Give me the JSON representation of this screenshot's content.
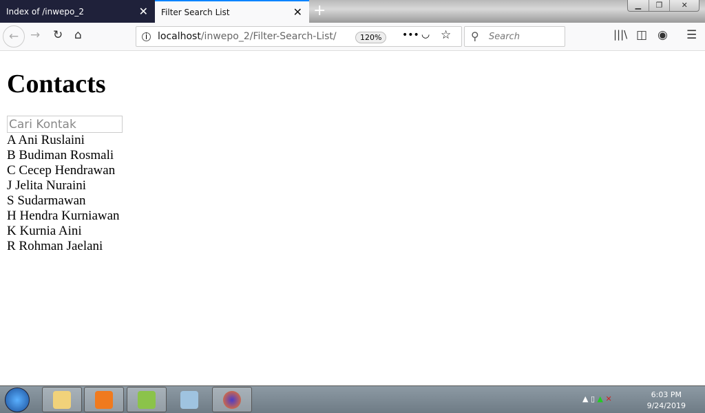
{
  "browser": {
    "tabs": [
      {
        "label": "Index of /inwepo_2",
        "active": false
      },
      {
        "label": "Filter Search List",
        "active": true
      }
    ],
    "url_host": "localhost",
    "url_path": "/inwepo_2/Filter-Search-List/",
    "zoom": "120%",
    "search_placeholder": "Search"
  },
  "page": {
    "title": "Contacts",
    "search_placeholder": "Cari Kontak",
    "contacts": [
      "A Ani Ruslaini",
      "B Budiman Rosmali",
      "C Cecep Hendrawan",
      "J Jelita Nuraini",
      "S Sudarmawan",
      "H Hendra Kurniawan",
      "K Kurnia Aini",
      "R Rohman Jaelani"
    ]
  },
  "taskbar": {
    "time": "6:03 PM",
    "date": "9/24/2019"
  }
}
